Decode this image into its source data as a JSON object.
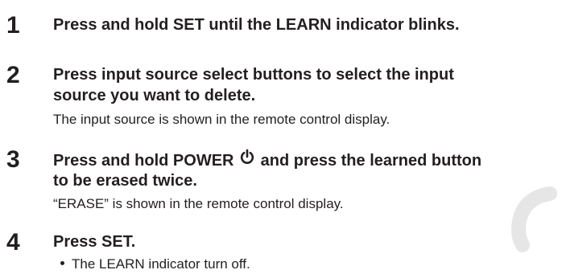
{
  "steps": [
    {
      "number": "1",
      "title": "Press and hold SET until the LEARN indicator blinks."
    },
    {
      "number": "2",
      "title_line1": "Press input source select buttons to select the input",
      "title_line2": "source you want to delete.",
      "description": "The input source is shown in the remote control display."
    },
    {
      "number": "3",
      "title_line1_before_icon": "Press and hold POWER",
      "title_line1_after_icon": "and press the learned button",
      "title_line2": "to be erased twice.",
      "description": "“ERASE” is shown in the remote control display.",
      "icon": "power-icon"
    },
    {
      "number": "4",
      "title": "Press SET.",
      "bullets": [
        "The LEARN indicator turn off."
      ]
    }
  ],
  "colors": {
    "text": "#231f20",
    "watermark": "#e6e6e6"
  }
}
